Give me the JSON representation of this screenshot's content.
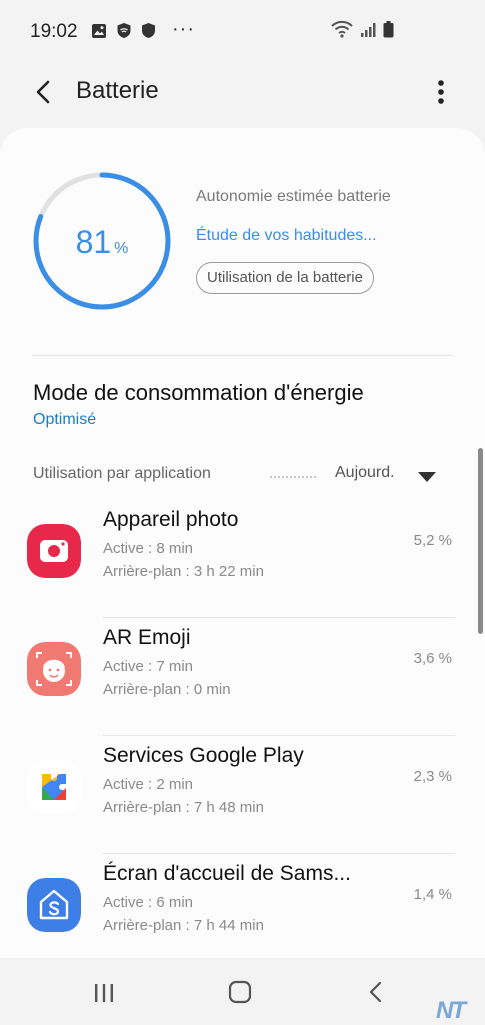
{
  "status_bar": {
    "time": "19:02",
    "dots": "···",
    "icons": [
      "image-icon",
      "shield-badge-icon",
      "shield-icon",
      "wifi-icon",
      "signal-icon",
      "battery-icon"
    ]
  },
  "header": {
    "title": "Batterie",
    "back_icon": "back-arrow-icon",
    "more_icon": "more-vert-icon"
  },
  "battery": {
    "level": "81",
    "level_unit": "%",
    "level_fraction": 0.81,
    "estimate_label": "Autonomie estimée batterie",
    "habit_link": "Étude de vos habitudes...",
    "usage_button": "Utilisation de la batterie",
    "accent_color": "#3a8ee6"
  },
  "power_mode": {
    "title": "Mode de consommation d'énergie",
    "value": "Optimisé"
  },
  "usage": {
    "header": "Utilisation par application",
    "period": "Aujourd.",
    "apps": [
      {
        "name": "Appareil photo",
        "active": "Active : 8 min",
        "background": "Arrière-plan : 3 h 22 min",
        "percent": "5,2 %",
        "icon": "camera-icon"
      },
      {
        "name": "AR Emoji",
        "active": "Active : 7 min",
        "background": "Arrière-plan : 0 min",
        "percent": "3,6 %",
        "icon": "ar-emoji-icon"
      },
      {
        "name": "Services Google Play",
        "active": "Active : 2 min",
        "background": "Arrière-plan : 7 h 48 min",
        "percent": "2,3 %",
        "icon": "google-play-services-icon"
      },
      {
        "name": "Écran d'accueil de Sams...",
        "active": "Active : 6 min",
        "background": "Arrière-plan : 7 h 44 min",
        "percent": "1,4 %",
        "icon": "samsung-home-icon"
      }
    ]
  },
  "nav_bar": {
    "icons": [
      "recents-icon",
      "home-icon",
      "back-icon"
    ]
  },
  "watermark": "NT"
}
